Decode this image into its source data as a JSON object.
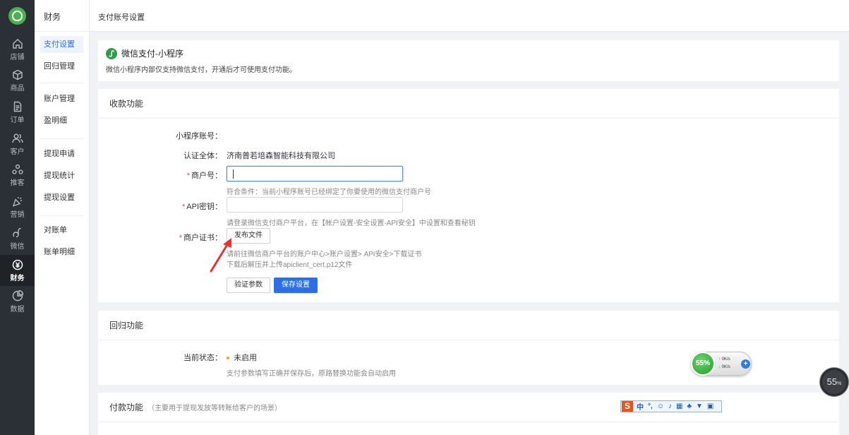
{
  "rail": {
    "items": [
      {
        "label": "店铺",
        "icon": "home-icon"
      },
      {
        "label": "商品",
        "icon": "box-icon"
      },
      {
        "label": "订单",
        "icon": "document-icon"
      },
      {
        "label": "客户",
        "icon": "users-icon"
      },
      {
        "label": "推客",
        "icon": "share-icon"
      },
      {
        "label": "营销",
        "icon": "party-icon"
      },
      {
        "label": "微信",
        "icon": "wechat-icon"
      },
      {
        "label": "财务",
        "icon": "yen-icon",
        "active": true
      },
      {
        "label": "数据",
        "icon": "pie-chart-icon"
      }
    ]
  },
  "subnav": {
    "title": "财务",
    "items": [
      "支付设置",
      "回归管理",
      "账户管理",
      "盈明细",
      "提现申请",
      "提现统计",
      "提现设置",
      "对账单",
      "账单明细"
    ],
    "active_index": 0
  },
  "topbar": {
    "title": "支付账号设置"
  },
  "banner": {
    "title": "微信支付-小程序",
    "desc": "微信小程序内部仅支持微信支付，开通后才可使用支付功能。"
  },
  "collect": {
    "section_title": "收款功能",
    "fields": {
      "appid_label": "小程序账号：",
      "entity_label": "认证全体：",
      "entity_value": "济南普若培森智能科技有限公司",
      "mchid_label": "商户号：",
      "mchid_value": "",
      "mchid_help": "符合条件：当前小程序账号已经绑定了你要使用的微信支付商户号",
      "apikey_label": "API密钥：",
      "apikey_value": "",
      "apikey_help": "请登录微信支付商户平台，在【帐户设置-安全设置-API安全】中设置和查看秘钥",
      "cert_label": "商户证书：",
      "cert_button": "发布文件",
      "cert_help_1": "请前往微信商户平台的账户中心>账户设置> API安全>下载证书",
      "cert_help_2": "下载后解压并上传apiclient_cert.p12文件"
    },
    "verify_button": "验证参数",
    "save_button": "保存设置"
  },
  "refund": {
    "section_title": "回归功能",
    "status_label": "当前状态：",
    "status_value": "未启用",
    "help": "支付参数填写正确并保存后，原路替换功能会自动启用"
  },
  "pay": {
    "section_title": "付款功能",
    "hint": "（主要用于提现发放等转账给客户的场景）"
  },
  "widgets": {
    "speed_percent": "55%",
    "up_rate": "0K/s",
    "down_rate": "0K/s",
    "ring_percent": "55",
    "ring_unit": "%",
    "ime_logo": "S",
    "ime_lang": "中"
  },
  "colors": {
    "primary": "#2d6fe8",
    "required": "#e54545",
    "rail": "#2b2f36",
    "warning_dot": "#f5a623"
  }
}
